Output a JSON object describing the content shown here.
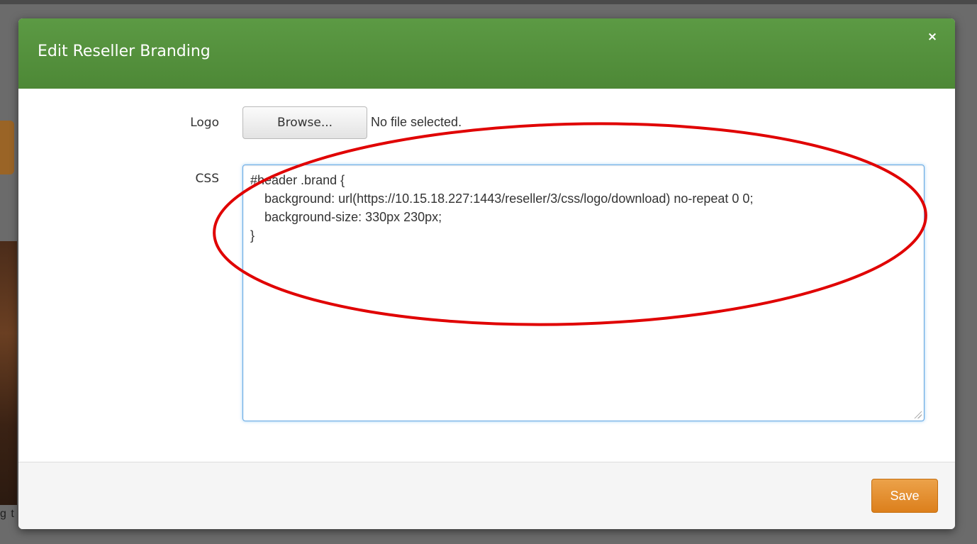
{
  "background": {
    "caption_fragment": "g t"
  },
  "modal": {
    "title": "Edit Reseller Branding",
    "close_glyph": "×",
    "header_color": "#559240",
    "logo": {
      "label": "Logo",
      "browse_label": "Browse...",
      "file_status": "No file selected."
    },
    "css": {
      "label": "CSS",
      "value": "#header .brand {\n    background: url(https://10.15.18.227:1443/reseller/3/css/logo/download) no-repeat 0 0;\n    background-size: 330px 230px;\n}"
    },
    "footer": {
      "save_label": "Save",
      "save_color": "#e08a2a"
    }
  },
  "annotation": {
    "shape": "ellipse",
    "color": "#e00000"
  }
}
